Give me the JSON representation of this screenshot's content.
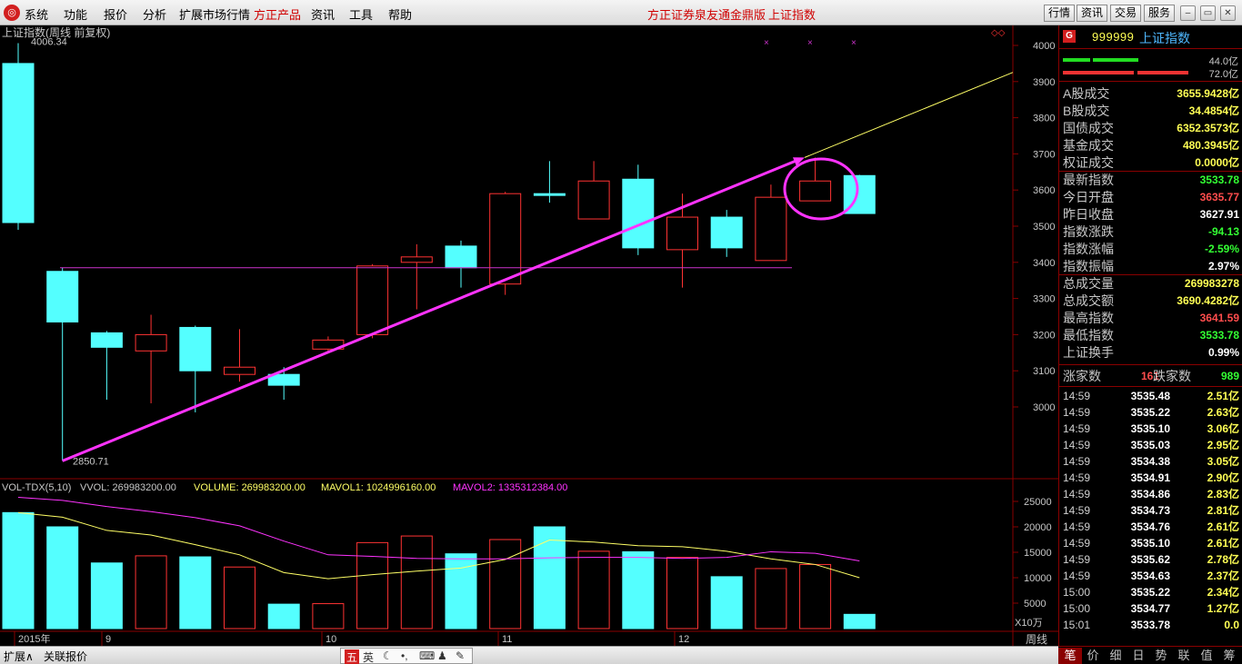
{
  "menu": {
    "items": [
      "系统",
      "功能",
      "报价",
      "分析",
      "扩展市场行情",
      "方正产品",
      "资讯",
      "工具",
      "帮助"
    ],
    "broker_title": "方正证券泉友通金鼎版",
    "index_title": "上证指数",
    "toolbar": [
      "行情",
      "资讯",
      "交易",
      "服务"
    ]
  },
  "chart": {
    "title": "上证指数(周线 前复权)",
    "high_label": "4006.34",
    "low_label": "2850.71",
    "diamond": "◇◇",
    "price_ticks": [
      "4000",
      "3900",
      "3800",
      "3700",
      "3600",
      "3500",
      "3400",
      "3300",
      "3200",
      "3100",
      "3000"
    ],
    "vol_ticks": [
      "25000",
      "20000",
      "15000",
      "10000",
      "5000"
    ],
    "vol_unit": "X10万",
    "period": "周线",
    "date_labels": [
      "2015年",
      "9",
      "10",
      "11",
      "12"
    ]
  },
  "indicator": {
    "name": "VOL-TDX(5,10)",
    "vol": "VVOL: 269983200.00",
    "volume": "VOLUME: 269983200.00",
    "mavol1": "MAVOL1: 1024996160.00",
    "mavol2": "MAVOL2: 1335312384.00"
  },
  "chart_data": {
    "type": "candlestick",
    "title": "上证指数(周线 前复权)",
    "ylim": [
      2800,
      4050
    ],
    "candles": [
      {
        "o": 3950,
        "c": 3510,
        "h": 4006.34,
        "l": 3490
      },
      {
        "o": 3375,
        "c": 3235,
        "h": 3385,
        "l": 2850.71
      },
      {
        "o": 3205,
        "c": 3165,
        "h": 3210,
        "l": 3020
      },
      {
        "o": 3155,
        "c": 3200,
        "h": 3255,
        "l": 3010
      },
      {
        "o": 3220,
        "c": 3100,
        "h": 3225,
        "l": 2985
      },
      {
        "o": 3090,
        "c": 3110,
        "h": 3215,
        "l": 3070
      },
      {
        "o": 3090,
        "c": 3060,
        "h": 3110,
        "l": 3020
      },
      {
        "o": 3160,
        "c": 3185,
        "h": 3195,
        "l": 3150
      },
      {
        "o": 3200,
        "c": 3390,
        "h": 3395,
        "l": 3190
      },
      {
        "o": 3400,
        "c": 3415,
        "h": 3450,
        "l": 3270
      },
      {
        "o": 3445,
        "c": 3385,
        "h": 3460,
        "l": 3330
      },
      {
        "o": 3340,
        "c": 3590,
        "h": 3595,
        "l": 3310
      },
      {
        "o": 3590,
        "c": 3585,
        "h": 3680,
        "l": 3565
      },
      {
        "o": 3520,
        "c": 3625,
        "h": 3680,
        "l": 3520
      },
      {
        "o": 3630,
        "c": 3440,
        "h": 3670,
        "l": 3420
      },
      {
        "o": 3435,
        "c": 3525,
        "h": 3590,
        "l": 3330
      },
      {
        "o": 3525,
        "c": 3440,
        "h": 3545,
        "l": 3415
      },
      {
        "o": 3405,
        "c": 3580,
        "h": 3615,
        "l": 3405
      },
      {
        "o": 3570,
        "c": 3625,
        "h": 3690,
        "l": 3570
      },
      {
        "o": 3640,
        "c": 3535,
        "h": 3642,
        "l": 3534
      }
    ],
    "volumes": [
      22800,
      20000,
      12900,
      14300,
      14100,
      12100,
      4800,
      4900,
      16900,
      18200,
      14700,
      17500,
      20000,
      15200,
      15100,
      14000,
      10200,
      11800,
      12600,
      2800
    ],
    "mavol1": [
      22800,
      21900,
      19300,
      18400,
      16500,
      14500,
      11000,
      9800,
      10600,
      11300,
      11900,
      13600,
      17400,
      17000,
      16300,
      16100,
      15200,
      13700,
      12600,
      10000
    ],
    "mavol2": [
      25800,
      25200,
      24000,
      23000,
      21800,
      20200,
      17200,
      14500,
      14200,
      13800,
      13700,
      13700,
      13900,
      14000,
      14000,
      13800,
      14000,
      15100,
      14800,
      13300
    ]
  },
  "panel": {
    "code": "999999",
    "name": "上证指数",
    "bar1_label": "44.0亿",
    "bar2_label": "72.0亿",
    "stats": [
      {
        "label": "A股成交",
        "value": "3655.9428亿",
        "color": "#ffff55"
      },
      {
        "label": "B股成交",
        "value": "34.4854亿",
        "color": "#ffff55"
      },
      {
        "label": "国债成交",
        "value": "6352.3573亿",
        "color": "#ffff55"
      },
      {
        "label": "基金成交",
        "value": "480.3945亿",
        "color": "#ffff55"
      },
      {
        "label": "权证成交",
        "value": "0.0000亿",
        "color": "#ffff55"
      },
      {
        "label": "最新指数",
        "value": "3533.78",
        "color": "#33ff33"
      },
      {
        "label": "今日开盘",
        "value": "3635.77",
        "color": "#ff4d4d"
      },
      {
        "label": "昨日收盘",
        "value": "3627.91",
        "color": "#ffffff"
      },
      {
        "label": "指数涨跌",
        "value": "-94.13",
        "color": "#33ff33"
      },
      {
        "label": "指数涨幅",
        "value": "-2.59%",
        "color": "#33ff33"
      },
      {
        "label": "指数振幅",
        "value": "2.97%",
        "color": "#ffffff"
      },
      {
        "label": "总成交量",
        "value": "269983278",
        "color": "#ffff55"
      },
      {
        "label": "总成交额",
        "value": "3690.4282亿",
        "color": "#ffff55"
      },
      {
        "label": "最高指数",
        "value": "3641.59",
        "color": "#ff4d4d"
      },
      {
        "label": "最低指数",
        "value": "3533.78",
        "color": "#33ff33"
      },
      {
        "label": "上证换手",
        "value": "0.99%",
        "color": "#ffffff"
      }
    ],
    "up_label": "涨家数",
    "up_count": "161",
    "down_label": "跌家数",
    "down_count": "989",
    "ticks": [
      {
        "t": "14:59",
        "p": "3535.48",
        "v": "2.51亿",
        "c": "#ffff55"
      },
      {
        "t": "14:59",
        "p": "3535.22",
        "v": "2.63亿",
        "c": "#ffff55"
      },
      {
        "t": "14:59",
        "p": "3535.10",
        "v": "3.06亿",
        "c": "#ffff55"
      },
      {
        "t": "14:59",
        "p": "3535.03",
        "v": "2.95亿",
        "c": "#ffff55"
      },
      {
        "t": "14:59",
        "p": "3534.38",
        "v": "3.05亿",
        "c": "#ffff55"
      },
      {
        "t": "14:59",
        "p": "3534.91",
        "v": "2.90亿",
        "c": "#ffff55"
      },
      {
        "t": "14:59",
        "p": "3534.86",
        "v": "2.83亿",
        "c": "#ffff55"
      },
      {
        "t": "14:59",
        "p": "3534.73",
        "v": "2.81亿",
        "c": "#ffff55"
      },
      {
        "t": "14:59",
        "p": "3534.76",
        "v": "2.61亿",
        "c": "#ffff55"
      },
      {
        "t": "14:59",
        "p": "3535.10",
        "v": "2.61亿",
        "c": "#ffff55"
      },
      {
        "t": "14:59",
        "p": "3535.62",
        "v": "2.78亿",
        "c": "#ffff55"
      },
      {
        "t": "14:59",
        "p": "3534.63",
        "v": "2.37亿",
        "c": "#ffff55"
      },
      {
        "t": "15:00",
        "p": "3535.22",
        "v": "2.34亿",
        "c": "#ffff55"
      },
      {
        "t": "15:00",
        "p": "3534.77",
        "v": "1.27亿",
        "c": "#ffff55"
      },
      {
        "t": "15:01",
        "p": "3533.78",
        "v": "0.0",
        "c": "#ffff55"
      }
    ],
    "tabs": [
      "笔",
      "价",
      "细",
      "日",
      "势",
      "联",
      "值",
      "筹"
    ]
  },
  "bottom": {
    "expand": "扩展∧",
    "related": "关联报价",
    "ime": [
      "五",
      "英"
    ]
  },
  "colors": {
    "up": "#ff3333",
    "down": "#54ffff",
    "ma1": "#ffff66",
    "ma2": "#ff33ff",
    "trend": "#ff33ff"
  }
}
